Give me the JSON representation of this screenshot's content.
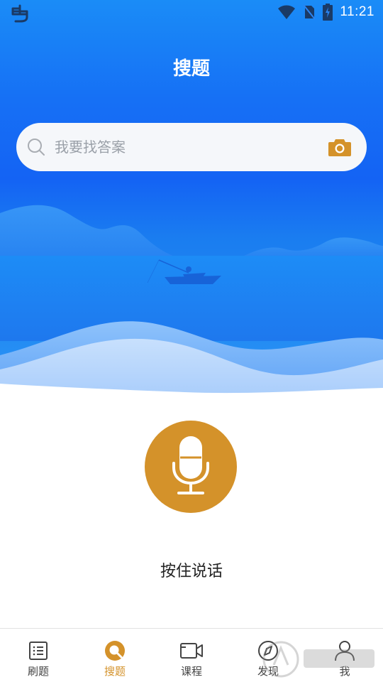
{
  "status_bar": {
    "time": "11:21",
    "icons": [
      "app-logo-icon",
      "wifi-icon",
      "no-sim-icon",
      "battery-charging-icon"
    ]
  },
  "header": {
    "title": "搜题"
  },
  "search": {
    "placeholder": "我要找答案",
    "value": "",
    "left_icon": "search-icon",
    "right_icon": "camera-icon"
  },
  "voice": {
    "icon": "microphone-icon",
    "label": "按住说话"
  },
  "tabbar": {
    "items": [
      {
        "label": "刷题",
        "icon": "list-icon",
        "active": false
      },
      {
        "label": "搜题",
        "icon": "search-tab-icon",
        "active": true
      },
      {
        "label": "课程",
        "icon": "video-icon",
        "active": false
      },
      {
        "label": "发现",
        "icon": "compass-icon",
        "active": false
      },
      {
        "label": "我",
        "icon": "user-icon",
        "active": false
      }
    ]
  },
  "colors": {
    "accent": "#d4922a",
    "hero_blue": "#1463f4",
    "search_bg": "#f5f7fa"
  }
}
